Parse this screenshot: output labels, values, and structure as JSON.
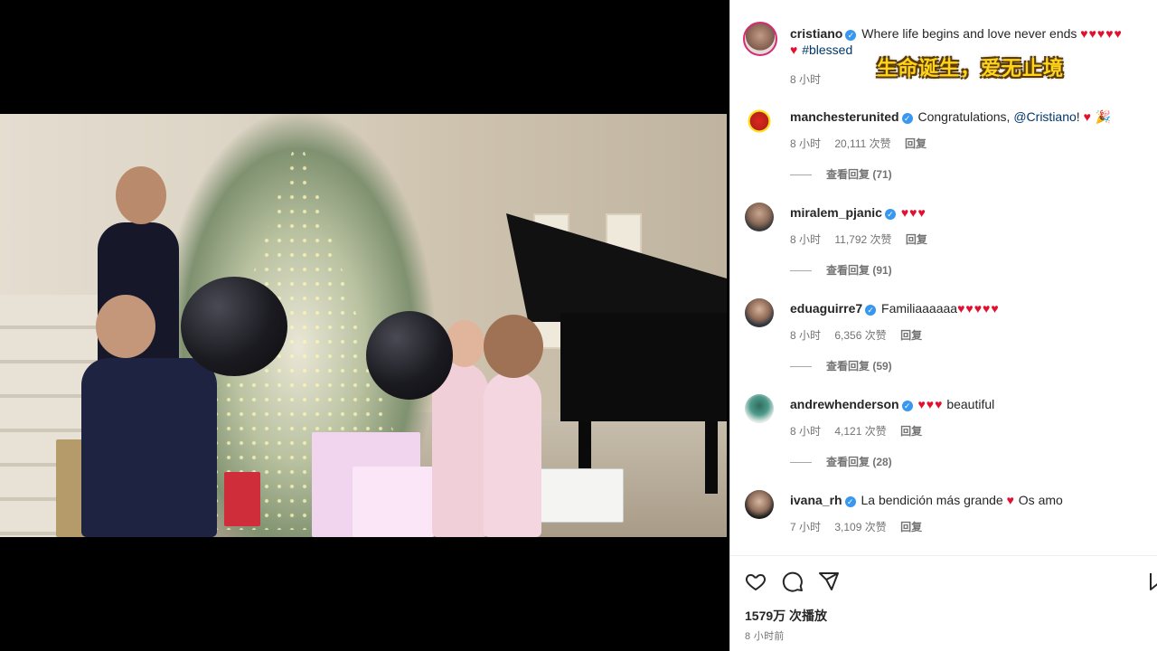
{
  "post": {
    "author": "cristiano",
    "caption_text": "Where life begins and love never ends",
    "caption_hearts": "♥♥♥♥♥",
    "caption_heart2": "♥",
    "hashtag": "#blessed",
    "time": "8 小时",
    "subtitle_overlay": "生命诞生，爱无止境"
  },
  "comments": [
    {
      "user": "manchesterunited",
      "text_before": "Congratulations, ",
      "mention": "@Cristiano",
      "text_after": "!",
      "emoji": "♥",
      "extra_emoji": "🎉",
      "time": "8 小时",
      "likes": "20,111 次赞",
      "reply": "回复",
      "view_replies": "查看回复 (71)"
    },
    {
      "user": "miralem_pjanic",
      "text": "",
      "emoji": "♥♥♥",
      "time": "8 小时",
      "likes": "11,792 次赞",
      "reply": "回复",
      "view_replies": "查看回复 (91)"
    },
    {
      "user": "eduaguirre7",
      "text": "Familiaaaaaa",
      "emoji": "♥♥♥♥♥",
      "time": "8 小时",
      "likes": "6,356 次赞",
      "reply": "回复",
      "view_replies": "查看回复 (59)"
    },
    {
      "user": "andrewhenderson",
      "text": "beautiful",
      "emoji": "♥♥♥",
      "time": "8 小时",
      "likes": "4,121 次赞",
      "reply": "回复",
      "view_replies": "查看回复 (28)"
    },
    {
      "user": "ivana_rh",
      "text_before": "La bendición más grande ",
      "emoji": "♥",
      "text_after": " Os amo",
      "time": "7 小时",
      "likes": "3,109 次赞",
      "reply": "回复"
    }
  ],
  "footer": {
    "views": "1579万 次播放",
    "time_ago": "8 小时前"
  },
  "icons": {
    "like": "heart-outline-icon",
    "comment": "comment-bubble-icon",
    "share": "paper-plane-icon",
    "save": "bookmark-icon",
    "verified": "verified-badge-icon"
  },
  "colors": {
    "verified": "#3897f0",
    "heart": "#e0102e",
    "link": "#00376b",
    "muted": "#737373",
    "subtitle": "#ffd41c"
  }
}
